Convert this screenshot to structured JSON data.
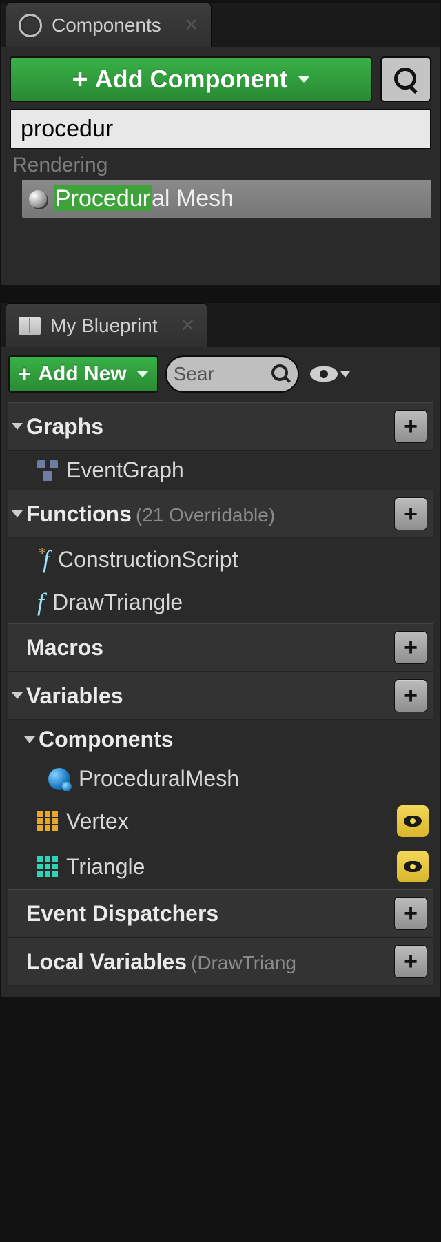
{
  "colors": {
    "accent": "#2fa63a"
  },
  "components_panel": {
    "tab_title": "Components",
    "add_button": "Add Component",
    "search_value": "procedur",
    "result_category": "Rendering",
    "result_label": "Procedural Mesh",
    "result_match": "Procedur",
    "result_rest": "al Mesh"
  },
  "blueprint_panel": {
    "tab_title": "My Blueprint",
    "add_button": "Add New",
    "search_placeholder": "Sear",
    "sections": {
      "graphs": {
        "label": "Graphs"
      },
      "functions": {
        "label": "Functions",
        "sub": "(21 Overridable)"
      },
      "macros": {
        "label": "Macros"
      },
      "variables": {
        "label": "Variables"
      },
      "components": {
        "label": "Components"
      },
      "event_dispatchers": {
        "label": "Event Dispatchers"
      },
      "local_variables": {
        "label": "Local Variables",
        "sub": "(DrawTriang"
      }
    },
    "items": {
      "event_graph": "EventGraph",
      "construction_script": "ConstructionScript",
      "draw_triangle": "DrawTriangle",
      "procedural_mesh": "ProceduralMesh",
      "vertex": "Vertex",
      "triangle": "Triangle"
    }
  }
}
